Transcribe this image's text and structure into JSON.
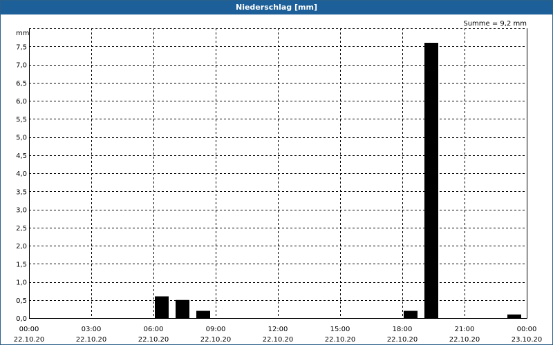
{
  "window": {
    "title": "Niederschlag [mm]"
  },
  "chart_data": {
    "type": "bar",
    "title": "Niederschlag [mm]",
    "annotation": "Summe = 9,2 mm",
    "ylabel": "mm",
    "ylim": [
      0,
      8
    ],
    "yticks": [
      "0,0",
      "0,5",
      "1,0",
      "1,5",
      "2,0",
      "2,5",
      "3,0",
      "3,5",
      "4,0",
      "4,5",
      "5,0",
      "5,5",
      "6,0",
      "6,5",
      "7,0",
      "7,5"
    ],
    "xlim_hours": [
      0,
      24
    ],
    "xticks": [
      {
        "time": "00:00",
        "date": "22.10.20"
      },
      {
        "time": "03:00",
        "date": "22.10.20"
      },
      {
        "time": "06:00",
        "date": "22.10.20"
      },
      {
        "time": "09:00",
        "date": "22.10.20"
      },
      {
        "time": "12:00",
        "date": "22.10.20"
      },
      {
        "time": "15:00",
        "date": "22.10.20"
      },
      {
        "time": "18:00",
        "date": "22.10.20"
      },
      {
        "time": "21:00",
        "date": "22.10.20"
      },
      {
        "time": "00:00",
        "date": "23.10.20"
      }
    ],
    "x_interval_hours": 1,
    "bars": [
      {
        "hour": 6,
        "value": 0.6
      },
      {
        "hour": 7,
        "value": 0.5
      },
      {
        "hour": 8,
        "value": 0.2
      },
      {
        "hour": 18,
        "value": 0.2
      },
      {
        "hour": 19,
        "value": 7.6
      },
      {
        "hour": 23,
        "value": 0.1
      }
    ],
    "grid": true,
    "bar_color": "#000000",
    "grid_color": "#000000"
  },
  "colors": {
    "titlebar": "#1d5f98",
    "title_text": "#ffffff",
    "background": "#ffffff"
  }
}
